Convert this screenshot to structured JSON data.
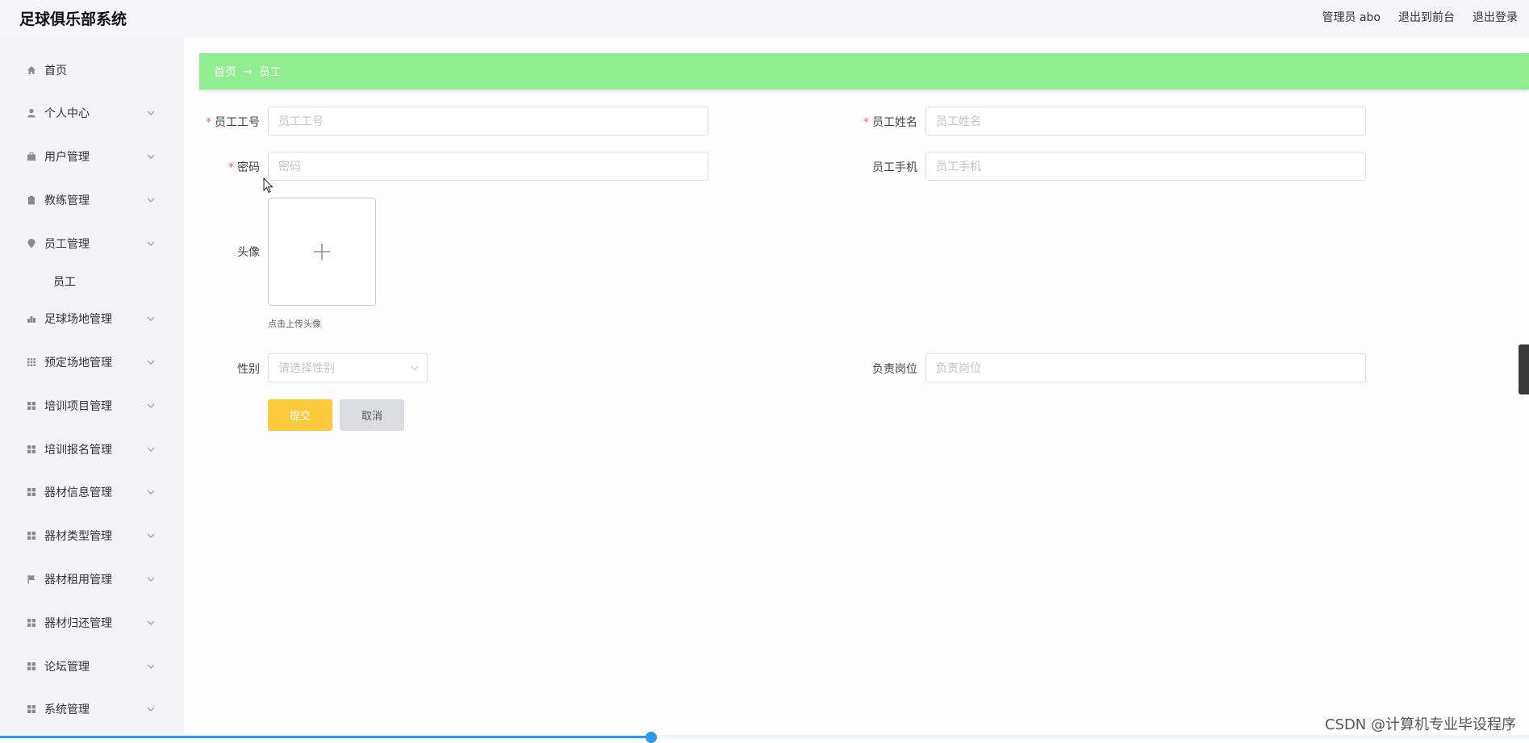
{
  "app": {
    "title": "足球俱乐部系统"
  },
  "header": {
    "user": "管理员 abo",
    "link_front": "退出到前台",
    "link_logout": "退出登录"
  },
  "sidebar": {
    "items": [
      {
        "label": "首页",
        "icon": "home-icon",
        "chevron": false
      },
      {
        "label": "个人中心",
        "icon": "user-icon",
        "chevron": true
      },
      {
        "label": "用户管理",
        "icon": "briefcase-icon",
        "chevron": true
      },
      {
        "label": "教练管理",
        "icon": "clipboard-icon",
        "chevron": true
      },
      {
        "label": "员工管理",
        "icon": "location-pin-icon",
        "chevron": true
      },
      {
        "label": "足球场地管理",
        "icon": "chart-icon",
        "chevron": true
      },
      {
        "label": "预定场地管理",
        "icon": "grid-icon",
        "chevron": true
      },
      {
        "label": "培训项目管理",
        "icon": "apps-icon",
        "chevron": true
      },
      {
        "label": "培训报名管理",
        "icon": "apps-icon",
        "chevron": true
      },
      {
        "label": "器材信息管理",
        "icon": "apps-icon",
        "chevron": true
      },
      {
        "label": "器材类型管理",
        "icon": "apps-icon",
        "chevron": true
      },
      {
        "label": "器材租用管理",
        "icon": "flag-icon",
        "chevron": true
      },
      {
        "label": "器材归还管理",
        "icon": "apps-icon",
        "chevron": true
      },
      {
        "label": "论坛管理",
        "icon": "apps-icon",
        "chevron": true
      },
      {
        "label": "系统管理",
        "icon": "apps-icon",
        "chevron": true
      }
    ],
    "submenu_label": "员工"
  },
  "breadcrumb": {
    "home": "首页",
    "separator": "→",
    "current": "员工"
  },
  "form": {
    "employee_no": {
      "label": "员工工号",
      "placeholder": "员工工号",
      "required": "*"
    },
    "employee_name": {
      "label": "员工姓名",
      "placeholder": "员工姓名",
      "required": "*"
    },
    "password": {
      "label": "密码",
      "placeholder": "密码",
      "required": "*"
    },
    "phone": {
      "label": "员工手机",
      "placeholder": "员工手机"
    },
    "avatar": {
      "label": "头像",
      "hint": "点击上传头像"
    },
    "gender": {
      "label": "性别",
      "placeholder": "请选择性别"
    },
    "position": {
      "label": "负责岗位",
      "placeholder": "负责岗位"
    },
    "submit": "提交",
    "cancel": "取消"
  },
  "progress": {
    "value": 0.426
  },
  "watermark": "CSDN @计算机专业毕设程序",
  "colors": {
    "breadcrumb_bg": "#90ee90",
    "submit_bg": "#fcca3a",
    "cancel_bg": "#dcdde1",
    "required": "#f56c6c",
    "progress": "#2b9af3"
  }
}
